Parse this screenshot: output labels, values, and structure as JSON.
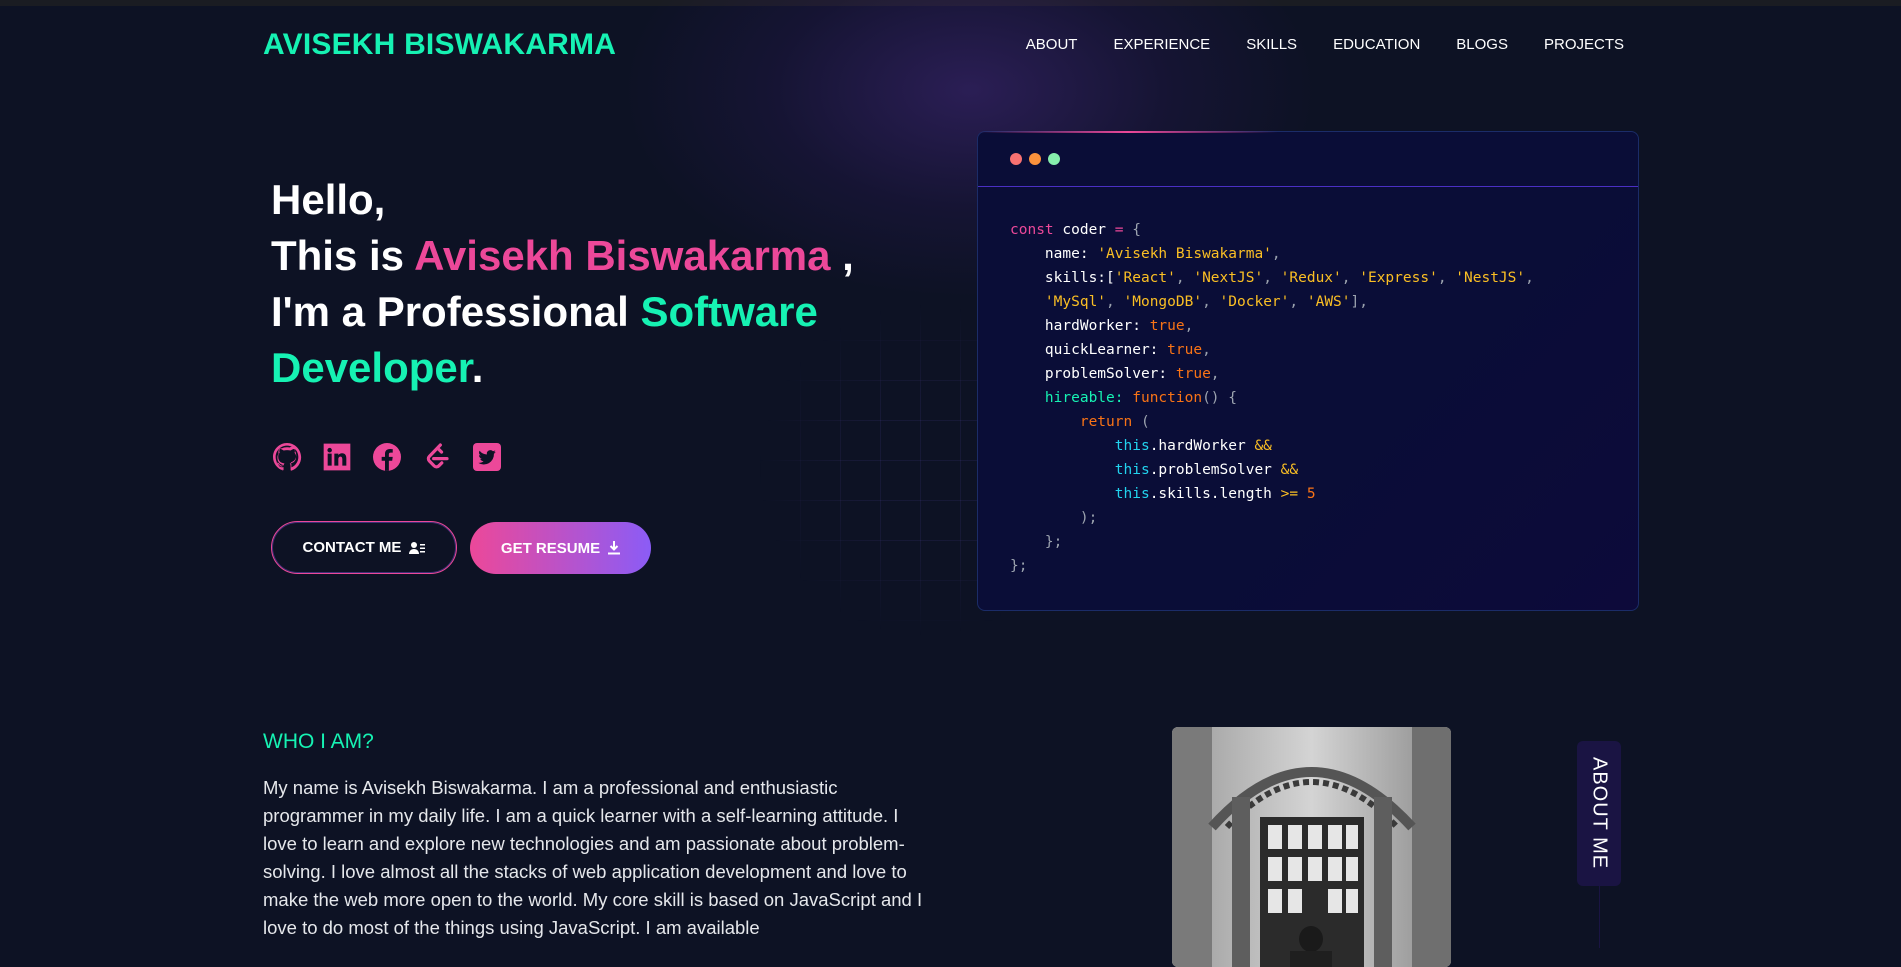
{
  "brand": "AVISEKH BISWAKARMA",
  "nav": [
    "ABOUT",
    "EXPERIENCE",
    "SKILLS",
    "EDUCATION",
    "BLOGS",
    "PROJECTS"
  ],
  "hero": {
    "line1": "Hello,",
    "line2_prefix": "This is ",
    "name": "Avisekh Biswakarma",
    "line2_suffix": " ,",
    "line3_prefix": "I'm a Professional ",
    "role": "Software Developer",
    "period": "."
  },
  "socials": [
    "github-icon",
    "linkedin-icon",
    "facebook-icon",
    "leetcode-icon",
    "twitter-icon"
  ],
  "buttons": {
    "contact": "CONTACT ME",
    "resume": "GET RESUME"
  },
  "code": {
    "dot_colors": [
      "#f87171",
      "#fb923c",
      "#86efac"
    ],
    "lines": {
      "l1a": "const",
      "l1b": " coder ",
      "l1c": "=",
      "l1d": " {",
      "name_key": "name:",
      "name_val": "'Avisekh Biswakarma'",
      "skills_key": "skills:[",
      "skills_1": [
        "'React'",
        "'NextJS'",
        "'Redux'",
        "'Express'",
        "'NestJS'"
      ],
      "skills_2": [
        "'MySql'",
        "'MongoDB'",
        "'Docker'",
        "'AWS'"
      ],
      "hard": "hardWorker:",
      "quick": "quickLearner:",
      "solver": "problemSolver:",
      "true": "true",
      "hireable": "hireable:",
      "function": "function",
      "return": "return",
      "this": "this",
      "hw": ".hardWorker ",
      "ps": ".problemSolver ",
      "sl": ".skills.length ",
      "and": "&&",
      "gte": ">=",
      "five": "5"
    }
  },
  "about": {
    "heading": "WHO I AM?",
    "text": "My name is Avisekh Biswakarma. I am a professional and enthusiastic programmer in my daily life. I am a quick learner with a self-learning attitude. I love to learn and explore new technologies and am passionate about problem-solving. I love almost all the stacks of web application development and love to make the web more open to the world. My core skill is based on JavaScript and I love to do most of the things using JavaScript. I am available",
    "tab": "ABOUT ME"
  }
}
